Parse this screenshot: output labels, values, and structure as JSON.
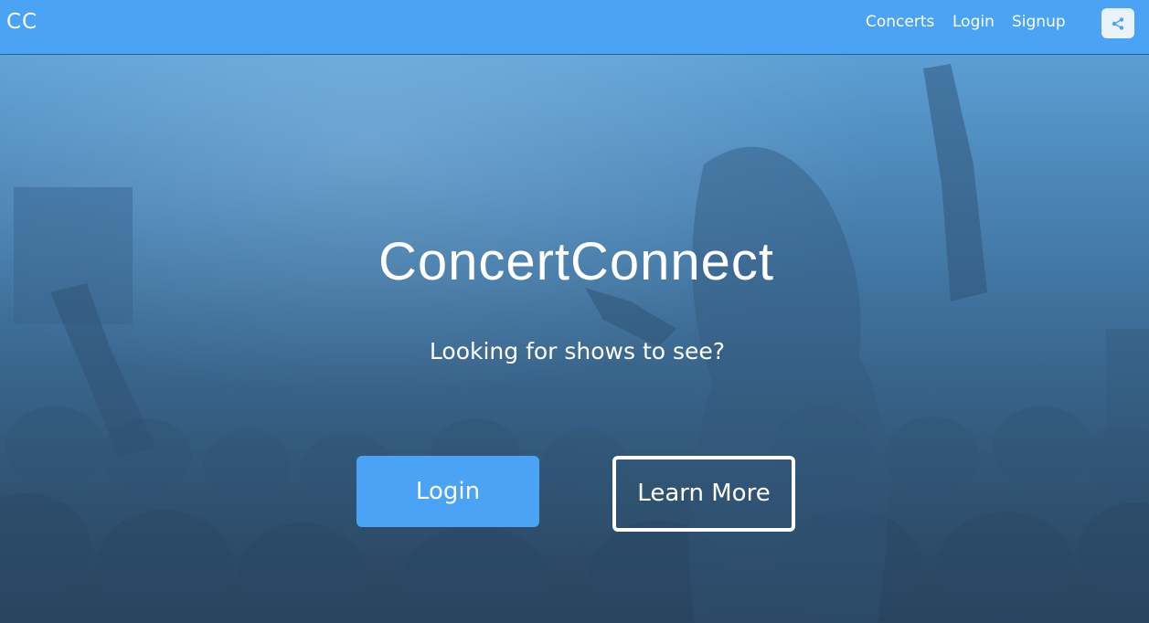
{
  "navbar": {
    "brand": "CC",
    "links": {
      "concerts": "Concerts",
      "login": "Login",
      "signup": "Signup"
    },
    "share_icon": "share-icon"
  },
  "hero": {
    "title": "ConcertConnect",
    "subtitle": "Looking for shows to see?",
    "primary_button": "Login",
    "secondary_button": "Learn More",
    "background": "concert crowd photo with blue overlay"
  },
  "colors": {
    "accent": "#4aa3f4",
    "nav_text": "#ffffff",
    "overlay_top": "#5c9fd4",
    "overlay_bottom": "#2f4e6a"
  }
}
